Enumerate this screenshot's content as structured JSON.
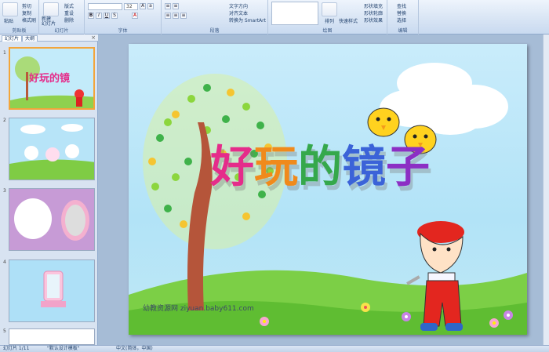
{
  "ribbon": {
    "clipboard": {
      "paste": "粘贴",
      "cut": "剪切",
      "copy": "复制",
      "format": "格式刷",
      "label": "剪贴板"
    },
    "slides": {
      "new_slide": "新建\n幻灯片",
      "layout": "版式",
      "reset": "重设",
      "delete": "删除",
      "label": "幻灯片"
    },
    "font": {
      "font_name": "",
      "font_size": "32",
      "label": "字体"
    },
    "paragraph": {
      "text_dir": "文字方向",
      "align_text": "对齐文本",
      "smartart": "转换为 SmartArt",
      "label": "段落"
    },
    "drawing": {
      "arrange": "排列",
      "quick_styles": "快速样式",
      "fill": "形状填充",
      "outline": "形状轮廓",
      "effects": "形状效果",
      "label": "绘图"
    },
    "editing": {
      "find": "查找",
      "replace": "替换",
      "select": "选择",
      "label": "编辑"
    }
  },
  "left_pane": {
    "tabs": [
      "幻灯片",
      "大纲"
    ],
    "close": "×",
    "slide_numbers": [
      "1",
      "2",
      "3",
      "4",
      "5"
    ]
  },
  "slide": {
    "title_chars": [
      "好",
      "玩",
      "的",
      "镜",
      "子"
    ],
    "title_colors": [
      "#e52c8a",
      "#f08a1c",
      "#35a84b",
      "#3b63d8",
      "#8c2fc4"
    ],
    "website": "幼教资源网  ziyuan.baby611.com"
  },
  "status_bar": {
    "slide_info": "幻灯片 1/11",
    "theme": "\"默认设计模板\"",
    "language": "中文(简体，中国)"
  }
}
